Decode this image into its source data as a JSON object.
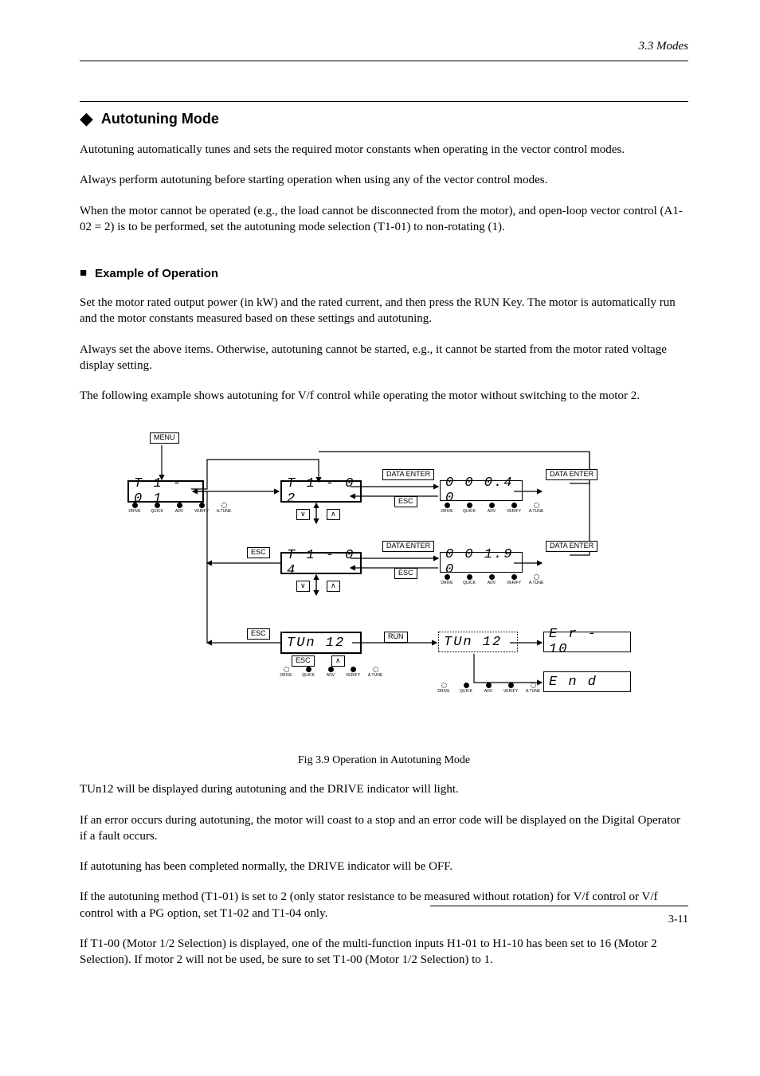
{
  "header": {
    "section_ref": "3.3 Modes"
  },
  "section": {
    "title": "Autotuning Mode",
    "p1": "Autotuning automatically tunes and sets the required motor constants when operating in the vector control modes.",
    "p2": "Always perform autotuning before starting operation when using any of the vector control modes.",
    "p3": "When the motor cannot be operated (e.g., the load cannot be disconnected from the motor), and open-loop vector control (A1-02 = 2) is to be performed, set the autotuning mode selection (T1-01) to non-rotating (1)."
  },
  "example": {
    "heading": "Example of Operation",
    "p1": "Set the motor rated output power (in kW) and the rated current, and then press the RUN Key. The motor is automatically run and the motor constants measured based on these settings and autotuning.",
    "p2": "Always set the above items. Otherwise, autotuning cannot be started, e.g., it cannot be started from the motor rated voltage display setting.",
    "p3": "The following example shows autotuning for V/f control while operating the motor without switching to the motor 2."
  },
  "diagram": {
    "menu": "MENU",
    "data_enter": "DATA\nENTER",
    "esc": "ESC",
    "run": "RUN",
    "seg": {
      "t1_01": "T 1 - 0 1",
      "t1_02": "T 1 - 0 2",
      "t1_04": "T 1 - 0 4",
      "tun12_a": "TUn 12",
      "tun12_b": "TUn 12",
      "v_00040": "0 0 0.4 0",
      "v_00190": "0 0 1.9 0",
      "er_10": "E r -  10",
      "end": "E n d"
    },
    "leds": [
      "DRIVE",
      "QUICK",
      "ADV",
      "VERIFY",
      "A.TUNE"
    ],
    "down_key": "∨",
    "up_key": "∧",
    "vert_arrow": "↕"
  },
  "caption": "Fig 3.9  Operation in Autotuning Mode",
  "post": {
    "p1": "TUn12 will be displayed during autotuning and the DRIVE indicator will light.",
    "p2": "If an error occurs during autotuning, the motor will coast to a stop and an error code will be displayed on the Digital Operator if a fault occurs.",
    "p3": "If autotuning has been completed normally, the DRIVE indicator will be OFF.",
    "p4": "If the autotuning method (T1-01) is set to 2 (only stator resistance to be measured without rotation) for V/f control or V/f control with a PG option, set T1-02 and T1-04 only.",
    "p5": "If T1-00 (Motor 1/2 Selection) is displayed, one of the multi-function inputs H1-01 to H1-10 has been set to 16 (Motor 2 Selection). If motor 2 will not be used, be sure to set T1-00 (Motor 1/2 Selection) to 1."
  },
  "pagenum": "3-11"
}
